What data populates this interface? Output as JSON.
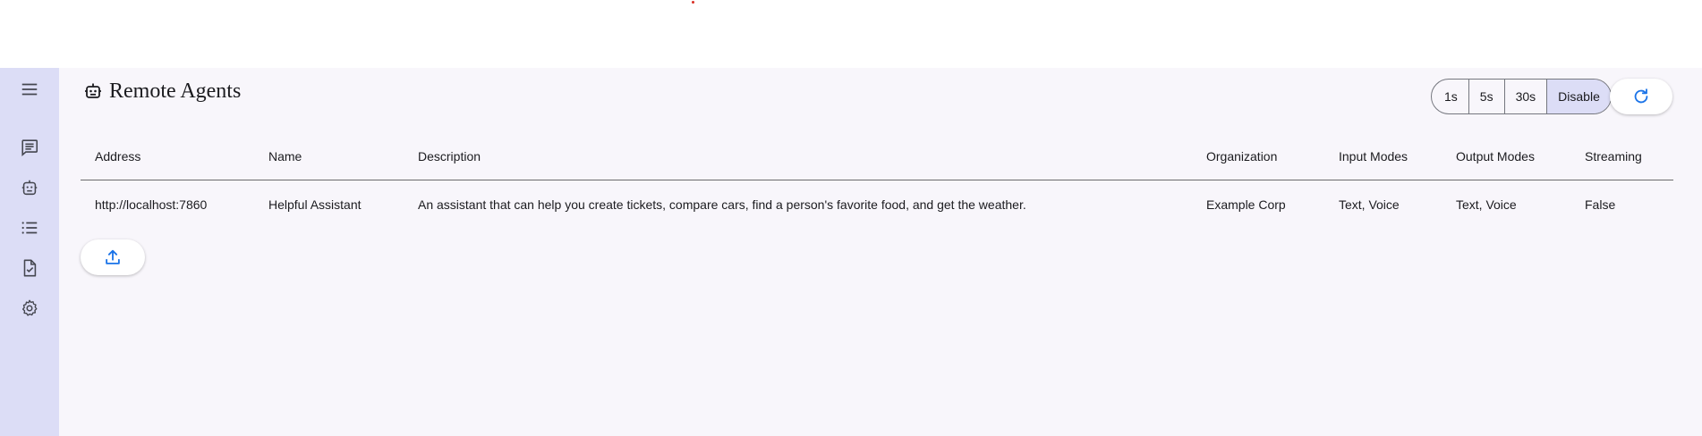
{
  "sidebar": {
    "items": [
      {
        "icon": "menu-icon"
      },
      {
        "icon": "chat-icon"
      },
      {
        "icon": "agent-icon"
      },
      {
        "icon": "list-icon"
      },
      {
        "icon": "task-icon"
      },
      {
        "icon": "settings-icon"
      }
    ]
  },
  "header": {
    "title": "Remote Agents",
    "title_icon": "robot-icon"
  },
  "refresh_interval": {
    "options": [
      "1s",
      "5s",
      "30s",
      "Disable"
    ],
    "selected": "Disable"
  },
  "refresh_button": {
    "icon": "refresh-icon"
  },
  "table": {
    "columns": [
      "Address",
      "Name",
      "Description",
      "Organization",
      "Input Modes",
      "Output Modes",
      "Streaming"
    ],
    "rows": [
      [
        "http://localhost:7860",
        "Helpful Assistant",
        "An assistant that can help you create tickets, compare cars, find a person's favorite food, and get the weather.",
        "Example Corp",
        "Text, Voice",
        "Text, Voice",
        "False"
      ]
    ]
  },
  "upload_button": {
    "icon": "upload-icon"
  },
  "colors": {
    "sidebar_bg": "#dcddf6",
    "page_bg": "#f8f6fb",
    "accent": "#1a73e8",
    "selected_segment": "#dcddf6"
  }
}
